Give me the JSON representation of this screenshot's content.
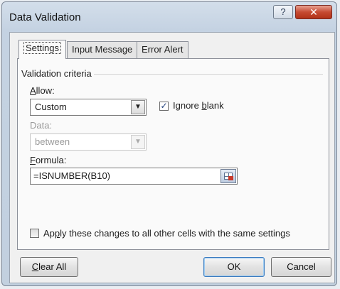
{
  "window": {
    "title": "Data Validation",
    "help_glyph": "?",
    "close_glyph": "✕"
  },
  "tabs": [
    {
      "label": "Settings",
      "active": true
    },
    {
      "label": "Input Message",
      "active": false
    },
    {
      "label": "Error Alert",
      "active": false
    }
  ],
  "group": {
    "label": "Validation criteria"
  },
  "allow": {
    "label_mnemonic": "A",
    "label_rest": "llow:",
    "value": "Custom"
  },
  "ignore_blank": {
    "label_pre": "Ignore ",
    "label_mnemonic": "b",
    "label_post": "lank",
    "checked": true
  },
  "data_field": {
    "label": "Data:",
    "value": "between",
    "disabled": true
  },
  "formula": {
    "label_mnemonic": "F",
    "label_rest": "ormula:",
    "value": "=ISNUMBER(B10)"
  },
  "apply_all": {
    "label_pre": "Ap",
    "label_mnemonic": "p",
    "label_post": "ly these changes to all other cells with the same settings",
    "checked": false
  },
  "buttons": {
    "clear_mnemonic": "C",
    "clear_rest": "lear All",
    "ok": "OK",
    "cancel": "Cancel"
  },
  "icons": {
    "dropdown": "chevron-down-icon",
    "collapse": "range-selector-icon",
    "check": "checkmark-icon"
  }
}
